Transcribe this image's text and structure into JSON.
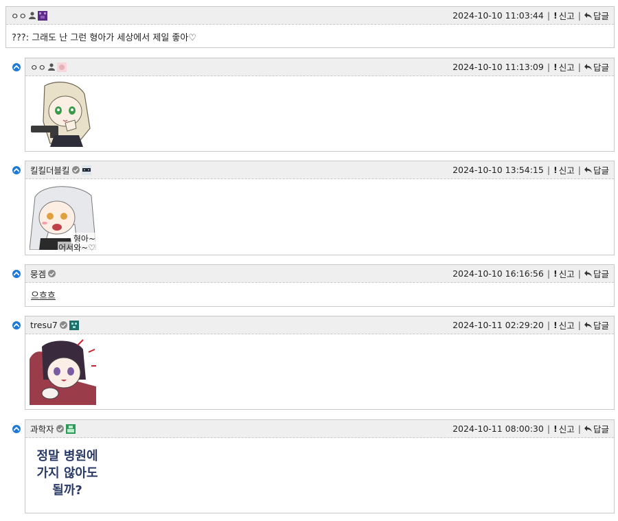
{
  "icons": {
    "person": "person-icon",
    "check": "verified-check-icon",
    "report": "exclamation-icon",
    "reply": "reply-arrow-icon",
    "reply_bullet": "chevron-up-circle-icon"
  },
  "colors": {
    "header_bg": "#efefef",
    "border": "#c8c8c8",
    "bullet": "#1e7ad4"
  },
  "actions": {
    "report": "신고",
    "reply": "답글"
  },
  "comments": [
    {
      "user": "ㅇㅇ",
      "timestamp": "2024-10-10 11:03:44",
      "text": "???: 그래도 난 그런 형아가 세상에서 제일 좋아♡"
    },
    {
      "user": "ㅇㅇ",
      "timestamp": "2024-10-10 11:13:09",
      "sticker": "anime-girl-gun-sticker"
    },
    {
      "user": "킬킬더블킬",
      "timestamp": "2024-10-10 13:54:15",
      "sticker_caption_1": "형아~",
      "sticker_caption_2": "어서와~♡"
    },
    {
      "user": "뭉겜",
      "timestamp": "2024-10-10 16:16:56",
      "text": "으흐흐"
    },
    {
      "user": "tresu7",
      "timestamp": "2024-10-11 02:29:20",
      "sticker": "anime-girl-red-sticker"
    },
    {
      "user": "과학자",
      "timestamp": "2024-10-11 08:00:30",
      "sticker_text_1": "정말 병원에",
      "sticker_text_2": "가지 않아도",
      "sticker_text_3": "될까?"
    }
  ]
}
